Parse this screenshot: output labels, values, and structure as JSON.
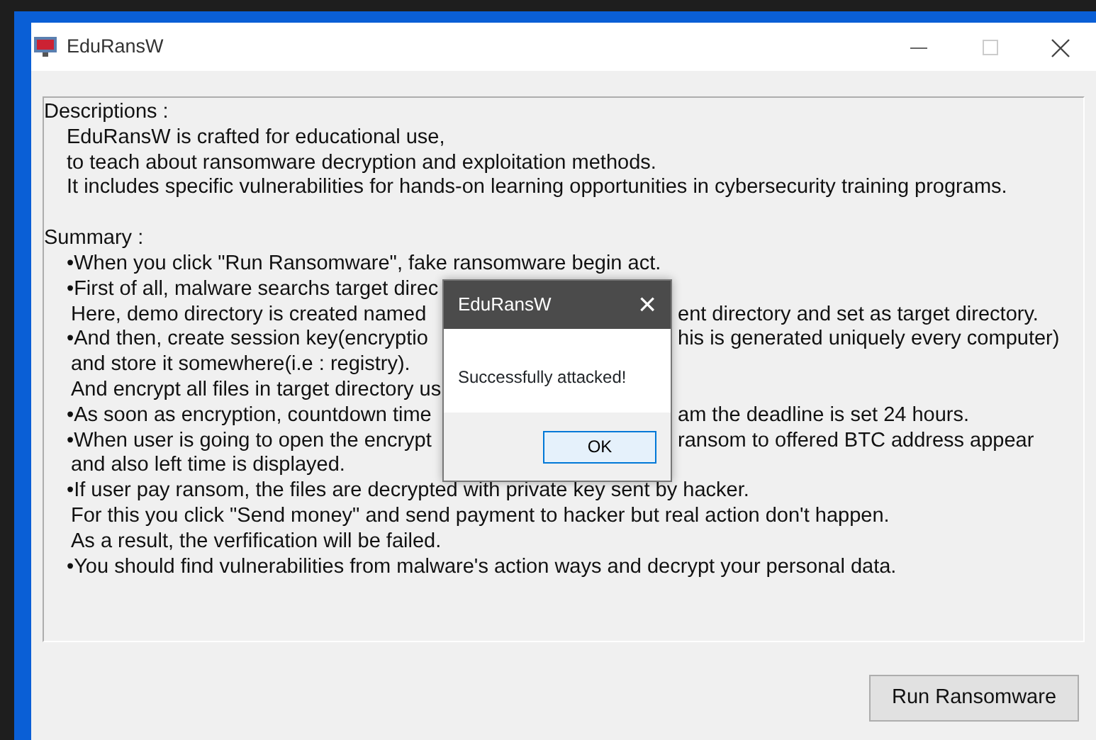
{
  "window": {
    "title": "EduRansW"
  },
  "description": {
    "heading": "Descriptions :",
    "lines": [
      "EduRansW is crafted for educational use,",
      "to teach about ransomware decryption and exploitation methods.",
      "It includes specific vulnerabilities for hands-on learning opportunities in cybersecurity training programs."
    ]
  },
  "summary": {
    "heading": "Summary :",
    "lines": [
      {
        "kind": "bullet",
        "text": "•When you click \"Run Ransomware\", fake ransomware begin act."
      },
      {
        "kind": "bullet",
        "text": "•First of all, malware searchs target direc"
      },
      {
        "kind": "cont",
        "text": "Here, demo directory is created named",
        "after": "ent directory and set as target directory."
      },
      {
        "kind": "bullet",
        "text": "•And then, create session key(encryptio",
        "after": "his is generated uniquely every computer)"
      },
      {
        "kind": "cont",
        "text": "and store it somewhere(i.e : registry)."
      },
      {
        "kind": "cont",
        "text": "And encrypt all files in target directory us"
      },
      {
        "kind": "bullet",
        "text": "•As soon as encryption, countdown time",
        "after": "am the deadline is set 24 hours."
      },
      {
        "kind": "bullet",
        "text": "•When user is going to open the encrypt",
        "after": "ransom to offered BTC address appear"
      },
      {
        "kind": "cont",
        "text": "and also left time is displayed."
      },
      {
        "kind": "bullet",
        "text": "•If user pay ransom, the files are decrypted with private key sent by hacker."
      },
      {
        "kind": "cont",
        "text": "For this you click \"Send money\" and send payment to hacker but real action don't happen."
      },
      {
        "kind": "cont",
        "text": "As a result, the verfification will be failed."
      },
      {
        "kind": "bullet",
        "text": "•You should find vulnerabilities from malware's action ways and decrypt your personal data."
      }
    ]
  },
  "run_button": "Run Ransomware",
  "dialog": {
    "title": "EduRansW",
    "close": "×",
    "message": "Successfully attacked!",
    "ok": "OK"
  }
}
